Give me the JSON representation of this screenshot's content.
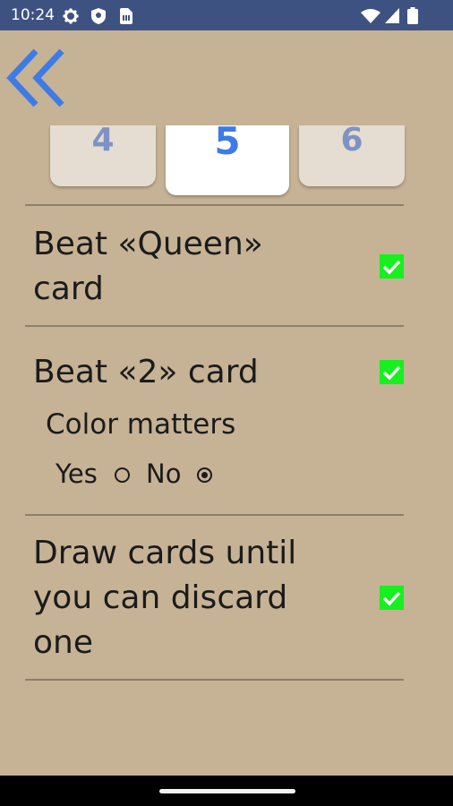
{
  "status_bar": {
    "time": "10:24",
    "icons": [
      "gear-icon",
      "shield-icon",
      "sim-card-icon",
      "wifi-icon",
      "cellular-signal-icon",
      "battery-icon"
    ]
  },
  "back_button": {
    "icon": "double-chevron-left-icon",
    "color": "#3f7be6"
  },
  "tabs": [
    {
      "label": "4",
      "active": false
    },
    {
      "label": "5",
      "active": true
    },
    {
      "label": "6",
      "active": false
    }
  ],
  "options": [
    {
      "label_line1": "Beat «Queen»",
      "label_line2": "card",
      "checked": true
    },
    {
      "label": "Beat «2» card",
      "checked": true,
      "sub_label": "Color matters",
      "radio_yes": "Yes",
      "radio_no": "No",
      "selected": "No"
    },
    {
      "label_line1": "Draw cards until",
      "label_line2": "you can discard",
      "label_line3": "one",
      "checked": true
    }
  ],
  "colors": {
    "background": "#c6b295",
    "status_bar": "#3e5282",
    "accent": "#3f7be6",
    "checkbox": "#16f01f",
    "tab_inactive": "#e5ddd1"
  }
}
